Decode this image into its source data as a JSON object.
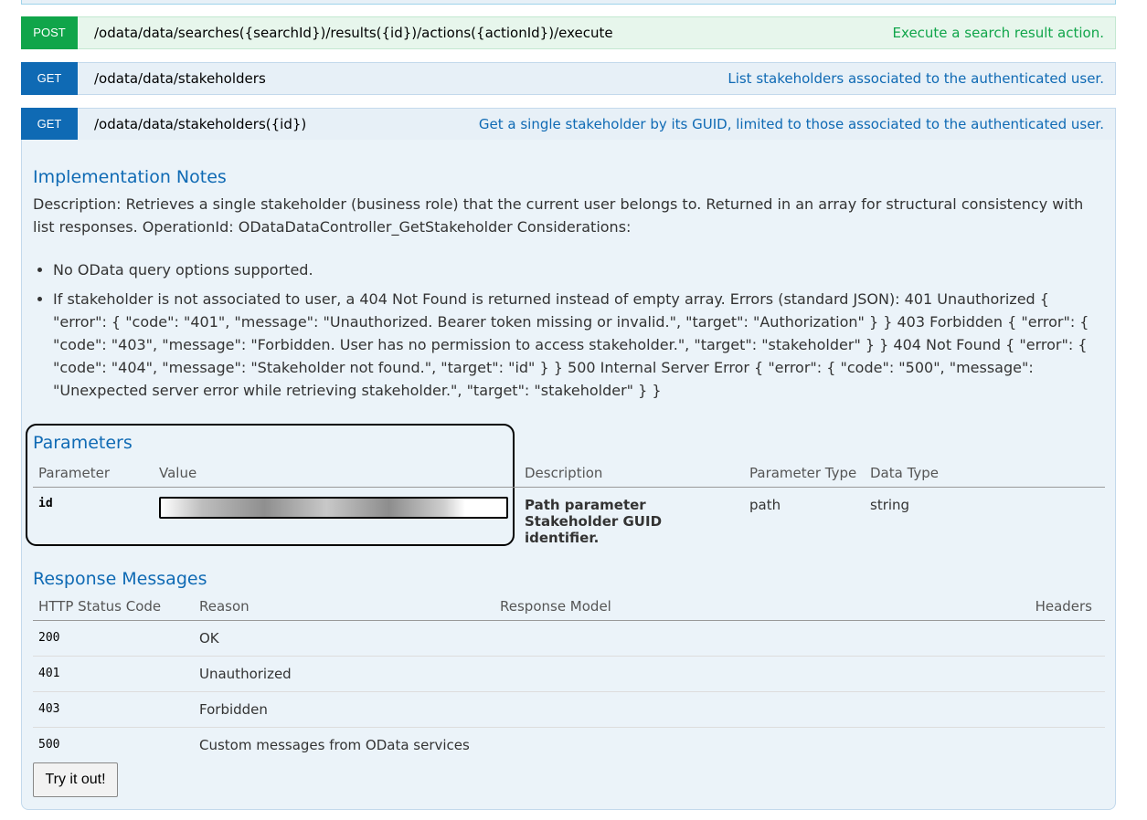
{
  "operations": [
    {
      "verb": "POST",
      "path": "/odata/data/searches({searchId})/results({id})/actions({actionId})/execute",
      "summary": "Execute a search result action."
    },
    {
      "verb": "GET",
      "path": "/odata/data/stakeholders",
      "summary": "List stakeholders associated to the authenticated user."
    },
    {
      "verb": "GET",
      "path": "/odata/data/stakeholders({id})",
      "summary": "Get a single stakeholder by its GUID, limited to those associated to the authenticated user."
    }
  ],
  "implementation": {
    "title": "Implementation Notes",
    "description": "Description: Retrieves a single stakeholder (business role) that the current user belongs to. Returned in an array for structural consistency with list responses. OperationId: ODataDataController_GetStakeholder Considerations:",
    "bullets": [
      "No OData query options supported.",
      "If stakeholder is not associated to user, a 404 Not Found is returned instead of empty array. Errors (standard JSON): 401 Unauthorized { \"error\": { \"code\": \"401\", \"message\": \"Unauthorized. Bearer token missing or invalid.\", \"target\": \"Authorization\" } } 403 Forbidden { \"error\": { \"code\": \"403\", \"message\": \"Forbidden. User has no permission to access stakeholder.\", \"target\": \"stakeholder\" } } 404 Not Found { \"error\": { \"code\": \"404\", \"message\": \"Stakeholder not found.\", \"target\": \"id\" } } 500 Internal Server Error { \"error\": { \"code\": \"500\", \"message\": \"Unexpected server error while retrieving stakeholder.\", \"target\": \"stakeholder\" } }"
    ]
  },
  "parameters": {
    "title": "Parameters",
    "headers": [
      "Parameter",
      "Value",
      "Description",
      "Parameter Type",
      "Data Type"
    ],
    "rows": [
      {
        "name": "id",
        "value": "",
        "description": "Path parameter Stakeholder GUID identifier.",
        "type": "path",
        "data_type": "string"
      }
    ]
  },
  "responses": {
    "title": "Response Messages",
    "headers": [
      "HTTP Status Code",
      "Reason",
      "Response Model",
      "Headers"
    ],
    "rows": [
      {
        "code": "200",
        "reason": "OK"
      },
      {
        "code": "401",
        "reason": "Unauthorized"
      },
      {
        "code": "403",
        "reason": "Forbidden"
      },
      {
        "code": "500",
        "reason": "Custom messages from OData services"
      }
    ]
  },
  "try_button": "Try it out!",
  "colors": {
    "post": "#10a54a",
    "get": "#0f6ab4",
    "title": "#0f6ab4"
  }
}
